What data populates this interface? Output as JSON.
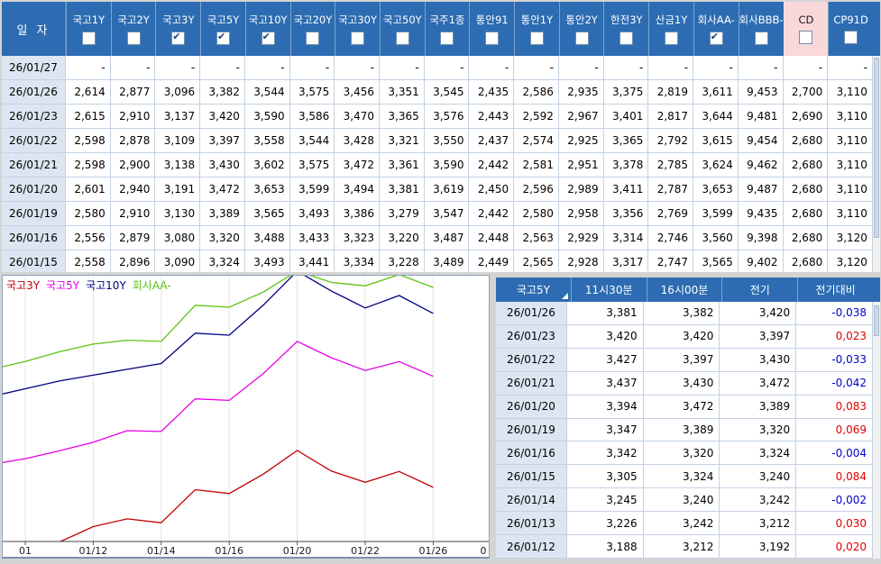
{
  "top_table": {
    "date_header": "일 자",
    "columns": [
      {
        "label": "국고1Y",
        "checked": false,
        "highlight": false
      },
      {
        "label": "국고2Y",
        "checked": false,
        "highlight": false
      },
      {
        "label": "국고3Y",
        "checked": true,
        "highlight": false
      },
      {
        "label": "국고5Y",
        "checked": true,
        "highlight": false
      },
      {
        "label": "국고10Y",
        "checked": true,
        "highlight": false
      },
      {
        "label": "국고20Y",
        "checked": false,
        "highlight": false
      },
      {
        "label": "국고30Y",
        "checked": false,
        "highlight": false
      },
      {
        "label": "국고50Y",
        "checked": false,
        "highlight": false
      },
      {
        "label": "국주1종",
        "checked": false,
        "highlight": false
      },
      {
        "label": "통안91",
        "checked": false,
        "highlight": false
      },
      {
        "label": "통안1Y",
        "checked": false,
        "highlight": false
      },
      {
        "label": "통안2Y",
        "checked": false,
        "highlight": false
      },
      {
        "label": "한전3Y",
        "checked": false,
        "highlight": false
      },
      {
        "label": "산금1Y",
        "checked": false,
        "highlight": false
      },
      {
        "label": "회사AA-",
        "checked": true,
        "highlight": false
      },
      {
        "label": "회사BBB-",
        "checked": false,
        "highlight": false
      },
      {
        "label": "CD",
        "checked": false,
        "highlight": true
      },
      {
        "label": "CP91D",
        "checked": false,
        "highlight": false
      }
    ],
    "rows": [
      {
        "date": "26/01/27",
        "values": [
          "-",
          "-",
          "-",
          "-",
          "-",
          "-",
          "-",
          "-",
          "-",
          "-",
          "-",
          "-",
          "-",
          "-",
          "-",
          "-",
          "-",
          "-"
        ]
      },
      {
        "date": "26/01/26",
        "values": [
          "2,614",
          "2,877",
          "3,096",
          "3,382",
          "3,544",
          "3,575",
          "3,456",
          "3,351",
          "3,545",
          "2,435",
          "2,586",
          "2,935",
          "3,375",
          "2,819",
          "3,611",
          "9,453",
          "2,700",
          "3,110"
        ]
      },
      {
        "date": "26/01/23",
        "values": [
          "2,615",
          "2,910",
          "3,137",
          "3,420",
          "3,590",
          "3,586",
          "3,470",
          "3,365",
          "3,576",
          "2,443",
          "2,592",
          "2,967",
          "3,401",
          "2,817",
          "3,644",
          "9,481",
          "2,690",
          "3,110"
        ]
      },
      {
        "date": "26/01/22",
        "values": [
          "2,598",
          "2,878",
          "3,109",
          "3,397",
          "3,558",
          "3,544",
          "3,428",
          "3,321",
          "3,550",
          "2,437",
          "2,574",
          "2,925",
          "3,365",
          "2,792",
          "3,615",
          "9,454",
          "2,680",
          "3,110"
        ]
      },
      {
        "date": "26/01/21",
        "values": [
          "2,598",
          "2,900",
          "3,138",
          "3,430",
          "3,602",
          "3,575",
          "3,472",
          "3,361",
          "3,590",
          "2,442",
          "2,581",
          "2,951",
          "3,378",
          "2,785",
          "3,624",
          "9,462",
          "2,680",
          "3,110"
        ]
      },
      {
        "date": "26/01/20",
        "values": [
          "2,601",
          "2,940",
          "3,191",
          "3,472",
          "3,653",
          "3,599",
          "3,494",
          "3,381",
          "3,619",
          "2,450",
          "2,596",
          "2,989",
          "3,411",
          "2,787",
          "3,653",
          "9,487",
          "2,680",
          "3,110"
        ]
      },
      {
        "date": "26/01/19",
        "values": [
          "2,580",
          "2,910",
          "3,130",
          "3,389",
          "3,565",
          "3,493",
          "3,386",
          "3,279",
          "3,547",
          "2,442",
          "2,580",
          "2,958",
          "3,356",
          "2,769",
          "3,599",
          "9,435",
          "2,680",
          "3,110"
        ]
      },
      {
        "date": "26/01/16",
        "values": [
          "2,556",
          "2,879",
          "3,080",
          "3,320",
          "3,488",
          "3,433",
          "3,323",
          "3,220",
          "3,487",
          "2,448",
          "2,563",
          "2,929",
          "3,314",
          "2,746",
          "3,560",
          "9,398",
          "2,680",
          "3,120"
        ]
      },
      {
        "date": "26/01/15",
        "values": [
          "2,558",
          "2,896",
          "3,090",
          "3,324",
          "3,493",
          "3,441",
          "3,334",
          "3,228",
          "3,489",
          "2,449",
          "2,565",
          "2,928",
          "3,317",
          "2,747",
          "3,565",
          "9,402",
          "2,680",
          "3,120"
        ]
      }
    ]
  },
  "chart_data": {
    "type": "line",
    "x": [
      "01/07",
      "01/08",
      "01/09",
      "01/12",
      "01/13",
      "01/14",
      "01/15",
      "01/16",
      "01/19",
      "01/20",
      "01/21",
      "01/22",
      "01/23",
      "01/26"
    ],
    "x_tick_labels": [
      "01",
      "01/12",
      "01/14",
      "01/16",
      "01/20",
      "01/22",
      "01/26",
      "0"
    ],
    "ylim_visible": [
      2.96,
      3.65
    ],
    "grid": "vertical-only",
    "legend_position": "top-left",
    "series": [
      {
        "name": "국고3Y",
        "color": "#c00000",
        "values": [
          2.88,
          2.9,
          2.955,
          2.995,
          3.015,
          3.005,
          3.09,
          3.08,
          3.13,
          3.191,
          3.138,
          3.109,
          3.137,
          3.096
        ]
      },
      {
        "name": "국고5Y",
        "color": "#e600e6",
        "values": [
          3.155,
          3.17,
          3.19,
          3.212,
          3.242,
          3.24,
          3.324,
          3.32,
          3.389,
          3.472,
          3.43,
          3.397,
          3.42,
          3.382
        ]
      },
      {
        "name": "국고10Y",
        "color": "#000080",
        "values": [
          3.33,
          3.35,
          3.37,
          3.385,
          3.4,
          3.415,
          3.493,
          3.488,
          3.565,
          3.653,
          3.602,
          3.558,
          3.59,
          3.544
        ]
      },
      {
        "name": "회사AA-",
        "color": "#5ac414",
        "values": [
          3.4,
          3.42,
          3.445,
          3.465,
          3.475,
          3.472,
          3.565,
          3.56,
          3.599,
          3.653,
          3.624,
          3.615,
          3.644,
          3.611
        ]
      }
    ]
  },
  "right_table": {
    "headers": [
      "국고5Y",
      "11시30분",
      "16시00분",
      "전기",
      "전기대비"
    ],
    "rows": [
      {
        "date": "26/01/26",
        "t1130": "3,381",
        "t1600": "3,382",
        "prev": "3,420",
        "diff": "-0,038",
        "dir": "down"
      },
      {
        "date": "26/01/23",
        "t1130": "3,420",
        "t1600": "3,420",
        "prev": "3,397",
        "diff": "0,023",
        "dir": "up"
      },
      {
        "date": "26/01/22",
        "t1130": "3,427",
        "t1600": "3,397",
        "prev": "3,430",
        "diff": "-0,033",
        "dir": "down"
      },
      {
        "date": "26/01/21",
        "t1130": "3,437",
        "t1600": "3,430",
        "prev": "3,472",
        "diff": "-0,042",
        "dir": "down"
      },
      {
        "date": "26/01/20",
        "t1130": "3,394",
        "t1600": "3,472",
        "prev": "3,389",
        "diff": "0,083",
        "dir": "up"
      },
      {
        "date": "26/01/19",
        "t1130": "3,347",
        "t1600": "3,389",
        "prev": "3,320",
        "diff": "0,069",
        "dir": "up"
      },
      {
        "date": "26/01/16",
        "t1130": "3,342",
        "t1600": "3,320",
        "prev": "3,324",
        "diff": "-0,004",
        "dir": "down"
      },
      {
        "date": "26/01/15",
        "t1130": "3,305",
        "t1600": "3,324",
        "prev": "3,240",
        "diff": "0,084",
        "dir": "up"
      },
      {
        "date": "26/01/14",
        "t1130": "3,245",
        "t1600": "3,240",
        "prev": "3,242",
        "diff": "-0,002",
        "dir": "down"
      },
      {
        "date": "26/01/13",
        "t1130": "3,226",
        "t1600": "3,242",
        "prev": "3,212",
        "diff": "0,030",
        "dir": "up"
      },
      {
        "date": "26/01/12",
        "t1130": "3,188",
        "t1600": "3,212",
        "prev": "3,192",
        "diff": "0,020",
        "dir": "up"
      }
    ]
  },
  "colors": {
    "header_bg": "#2d6cb2",
    "date_col_bg": "#dce6f2",
    "grid_line": "#c3d2e4",
    "cd_header_bg": "#f9d8da",
    "positive": "#e00000",
    "negative": "#0000cc"
  }
}
